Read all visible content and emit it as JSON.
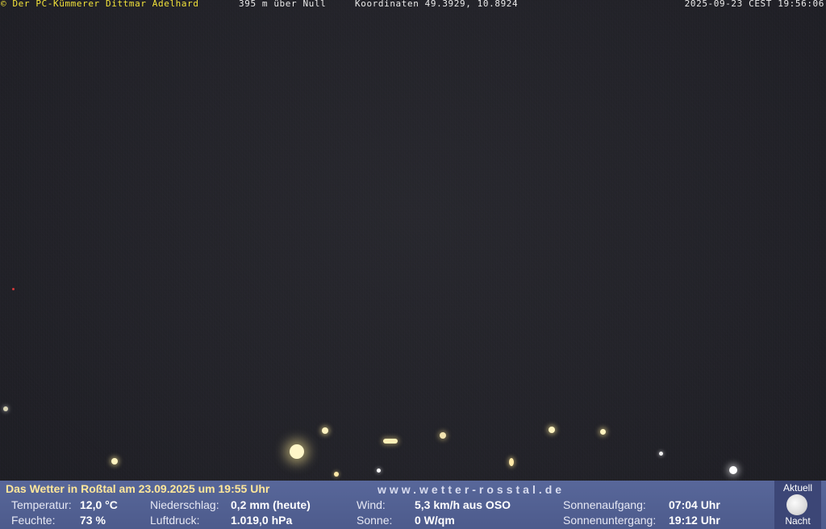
{
  "overlay": {
    "copyright": "© Der PC-Kümmerer Dittmar Adelhard",
    "altitude": "395 m über Null",
    "coordinates": "Koordinaten 49.3929, 10.8924",
    "timestamp": "2025-09-23 CEST 19:56:06"
  },
  "weather": {
    "heading": "Das Wetter in Roßtal am 23.09.2025 um 19:55 Uhr",
    "website": "www.wetter-rosstal.de",
    "temperature": {
      "label": "Temperatur:",
      "value": "12,0 °C"
    },
    "humidity": {
      "label": "Feuchte:",
      "value": "73 %"
    },
    "precipitation": {
      "label": "Niederschlag:",
      "value": "0,2 mm (heute)"
    },
    "pressure": {
      "label": "Luftdruck:",
      "value": "1.019,0 hPa"
    },
    "wind": {
      "label": "Wind:",
      "value": "5,3 km/h aus OSO"
    },
    "sun": {
      "label": "Sonne:",
      "value": "0 W/qm"
    },
    "sunrise": {
      "label": "Sonnenaufgang:",
      "value": "07:04 Uhr"
    },
    "sunset": {
      "label": "Sonnenuntergang:",
      "value": "19:12 Uhr"
    }
  },
  "status": {
    "label": "Aktuell",
    "phase": "Nacht",
    "icon": "moon-icon"
  }
}
